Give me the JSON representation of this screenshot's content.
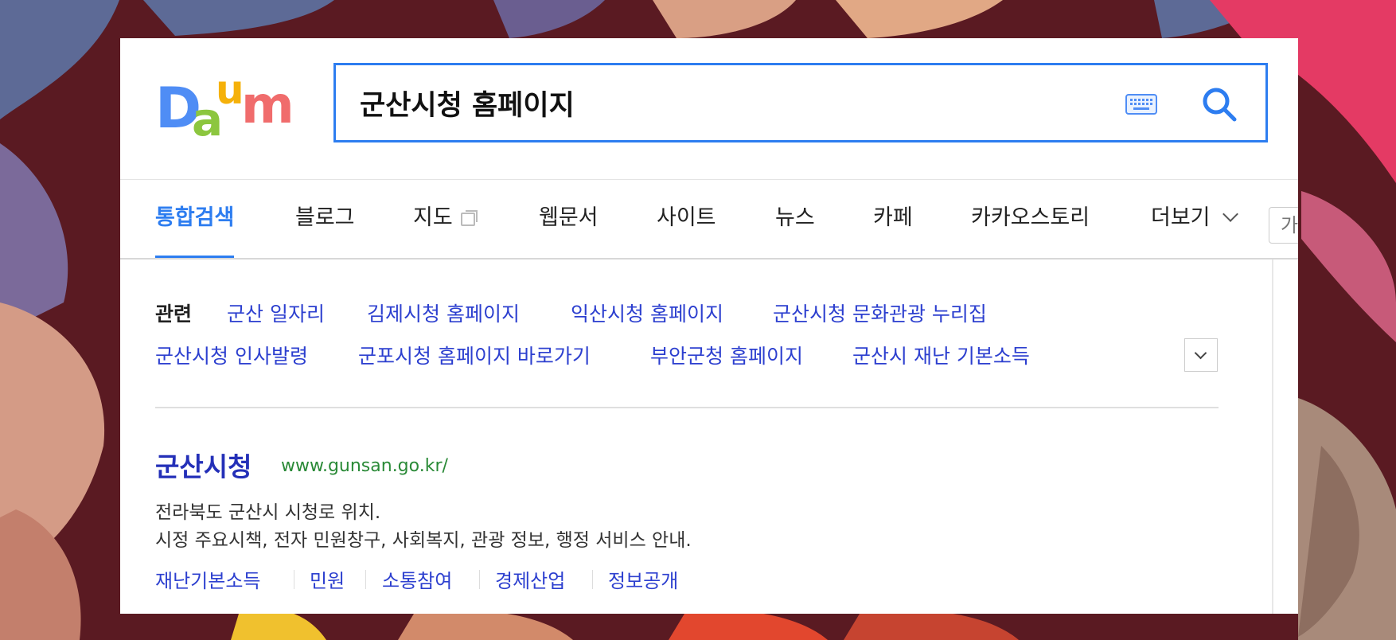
{
  "search": {
    "query": "군산시청 홈페이지",
    "keyboard_icon": "keyboard-icon",
    "search_icon": "search-icon"
  },
  "logo": {
    "letters": [
      "D",
      "a",
      "u",
      "m"
    ],
    "colors": [
      "#4f8df5",
      "#8cc63f",
      "#f5b10a",
      "#f06c6c"
    ]
  },
  "tabs": [
    {
      "label": "통합검색",
      "active": true
    },
    {
      "label": "블로그"
    },
    {
      "label": "지도"
    },
    {
      "label": "웹문서"
    },
    {
      "label": "사이트"
    },
    {
      "label": "뉴스"
    },
    {
      "label": "카페"
    },
    {
      "label": "카카오스토리"
    },
    {
      "label": "더보기"
    }
  ],
  "tab_extra": "가",
  "related": {
    "label": "관련",
    "items": [
      "군산 일자리",
      "김제시청 홈페이지",
      "익산시청 홈페이지",
      "군산시청 문화관광 누리집",
      "군산시청 인사발령",
      "군포시청 홈페이지 바로가기",
      "부안군청 홈페이지",
      "군산시 재난 기본소득"
    ]
  },
  "result": {
    "title": "군산시청",
    "url": "www.gunsan.go.kr/",
    "desc_line1": "전라북도 군산시 시청로 위치.",
    "desc_line2": "시정 주요시책, 전자 민원창구, 사회복지, 관광 정보, 행정 서비스 안내.",
    "sublinks": [
      "재난기본소득",
      "민원",
      "소통참여",
      "경제산업",
      "정보공개"
    ]
  },
  "colors": {
    "accent": "#2d7df0",
    "link": "#2c3fcf",
    "title_link": "#2430b8",
    "url_green": "#2a8a37",
    "background": "#5a1a22"
  }
}
